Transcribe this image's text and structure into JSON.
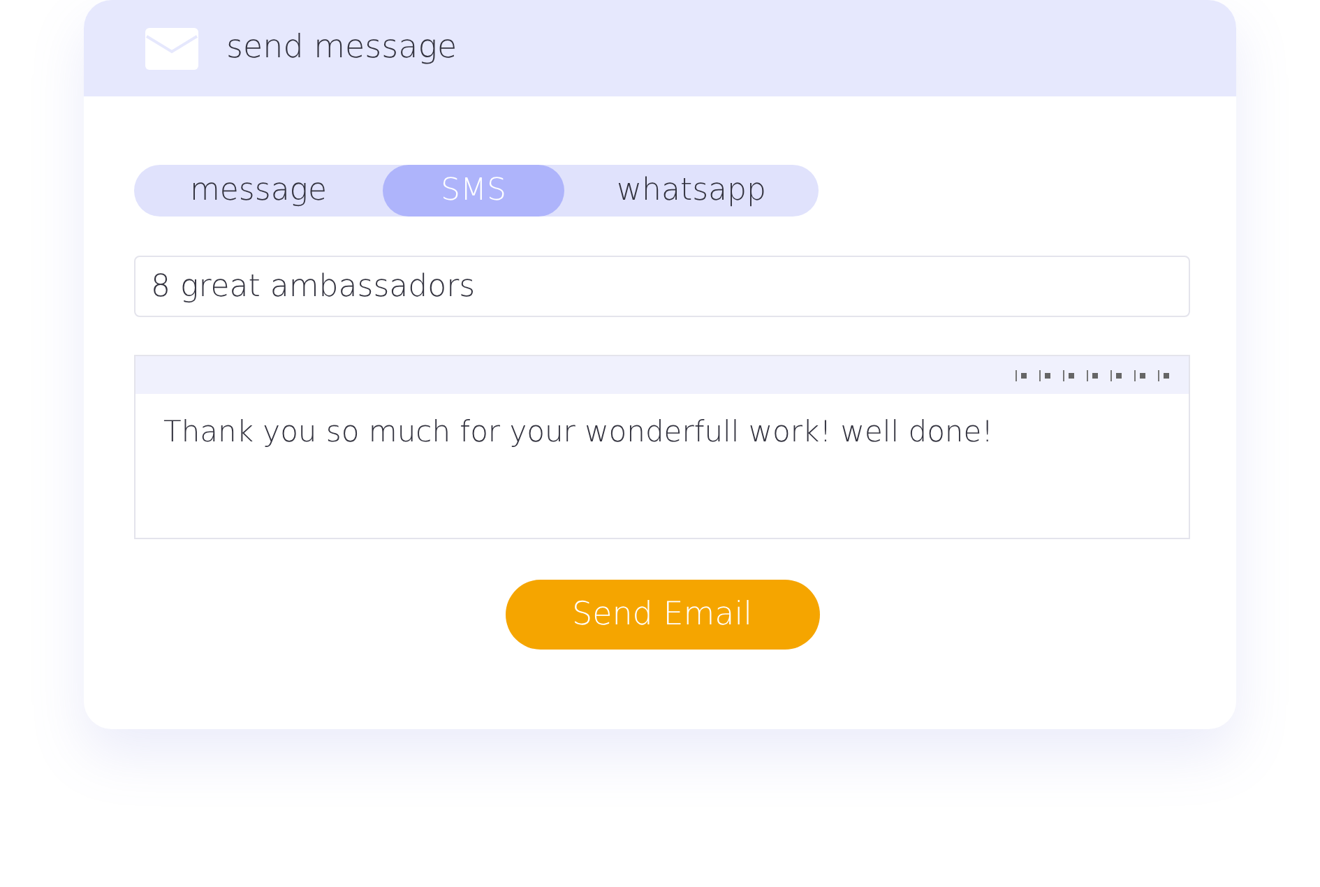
{
  "header": {
    "title": "send message"
  },
  "tabs": [
    {
      "label": "message",
      "selected": false
    },
    {
      "label": "SMS",
      "selected": true
    },
    {
      "label": "whatsapp",
      "selected": false
    }
  ],
  "recipients": {
    "value": "8 great ambassadors"
  },
  "editor": {
    "body": "Thank you so much for your wonderfull work! well done!"
  },
  "send_button": {
    "label": "Send Email"
  }
}
